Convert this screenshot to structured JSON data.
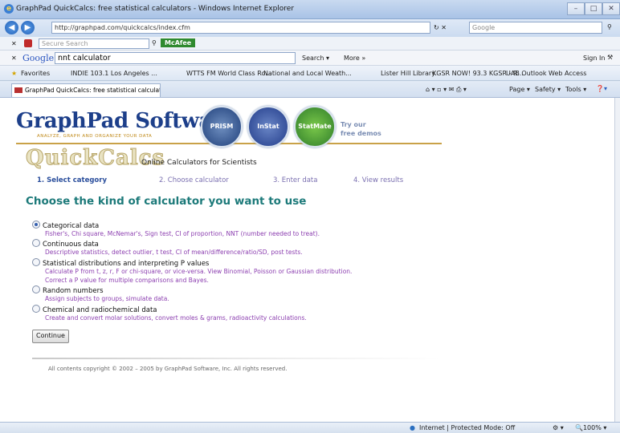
{
  "window": {
    "title": "GraphPad QuickCalcs: free statistical calculators - Windows Internet Explorer"
  },
  "address": {
    "url": "http://graphpad.com/quickcalcs/index.cfm",
    "search_placeholder": "Google"
  },
  "security_bar": {
    "search_placeholder": "Secure Search",
    "mcafee_label": "McAfee"
  },
  "google_bar": {
    "logo": "Google",
    "query": "nnt calculator",
    "search_label": "Search",
    "more_label": "More »",
    "sign_in": "Sign In"
  },
  "favorites": {
    "label": "Favorites",
    "items": [
      "INDIE 103.1 Los Angeles ...",
      "WTTS FM World Class Ro...",
      "National and Local Weath...",
      "Lister Hill Library",
      "KGSR NOW! 93.3 KGSR - R...",
      "UAB Outlook Web Access"
    ]
  },
  "tab": {
    "label": "GraphPad QuickCalcs: free statistical calculators",
    "tools": [
      "Page ▾",
      "Safety ▾",
      "Tools ▾"
    ]
  },
  "banner": {
    "logo": "GraphPad Software",
    "tagline": "ANALYZE, GRAPH AND ORGANIZE YOUR DATA",
    "products": [
      "PRISM",
      "InStat",
      "StatMate"
    ],
    "try_line1": "Try our",
    "try_line2": "free demos"
  },
  "quickcalcs": {
    "logo": "QuickCalcs",
    "subtitle": "Online Calculators for Scientists"
  },
  "steps": [
    "1. Select category",
    "2. Choose calculator",
    "3. Enter data",
    "4. View results"
  ],
  "heading": "Choose the kind of calculator you want to use",
  "options": [
    {
      "label": "Categorical data",
      "desc": [
        "Fisher's, Chi square, McNemar's, Sign test, CI of proportion, NNT (number needed to treat)."
      ]
    },
    {
      "label": "Continuous data",
      "desc": [
        "Descriptive statistics, detect outlier, t test, CI of mean/difference/ratio/SD, post tests."
      ]
    },
    {
      "label": "Statistical distributions and interpreting P values",
      "desc": [
        "Calculate P from t, z, r, F or chi-square, or vice-versa. View Binomial, Poisson or Gaussian distribution.",
        "Correct a P value for multiple comparisons and Bayes."
      ]
    },
    {
      "label": "Random numbers",
      "desc": [
        "Assign subjects to groups, simulate data."
      ]
    },
    {
      "label": "Chemical and radiochemical data",
      "desc": [
        "Create and convert molar solutions, convert moles & grams, radioactivity calculations."
      ]
    }
  ],
  "continue_label": "Continue",
  "copyright": "All contents copyright © 2002 – 2005 by GraphPad Software, Inc. All rights reserved.",
  "status": {
    "zone": "Internet | Protected Mode: Off",
    "zoom": "100%"
  }
}
